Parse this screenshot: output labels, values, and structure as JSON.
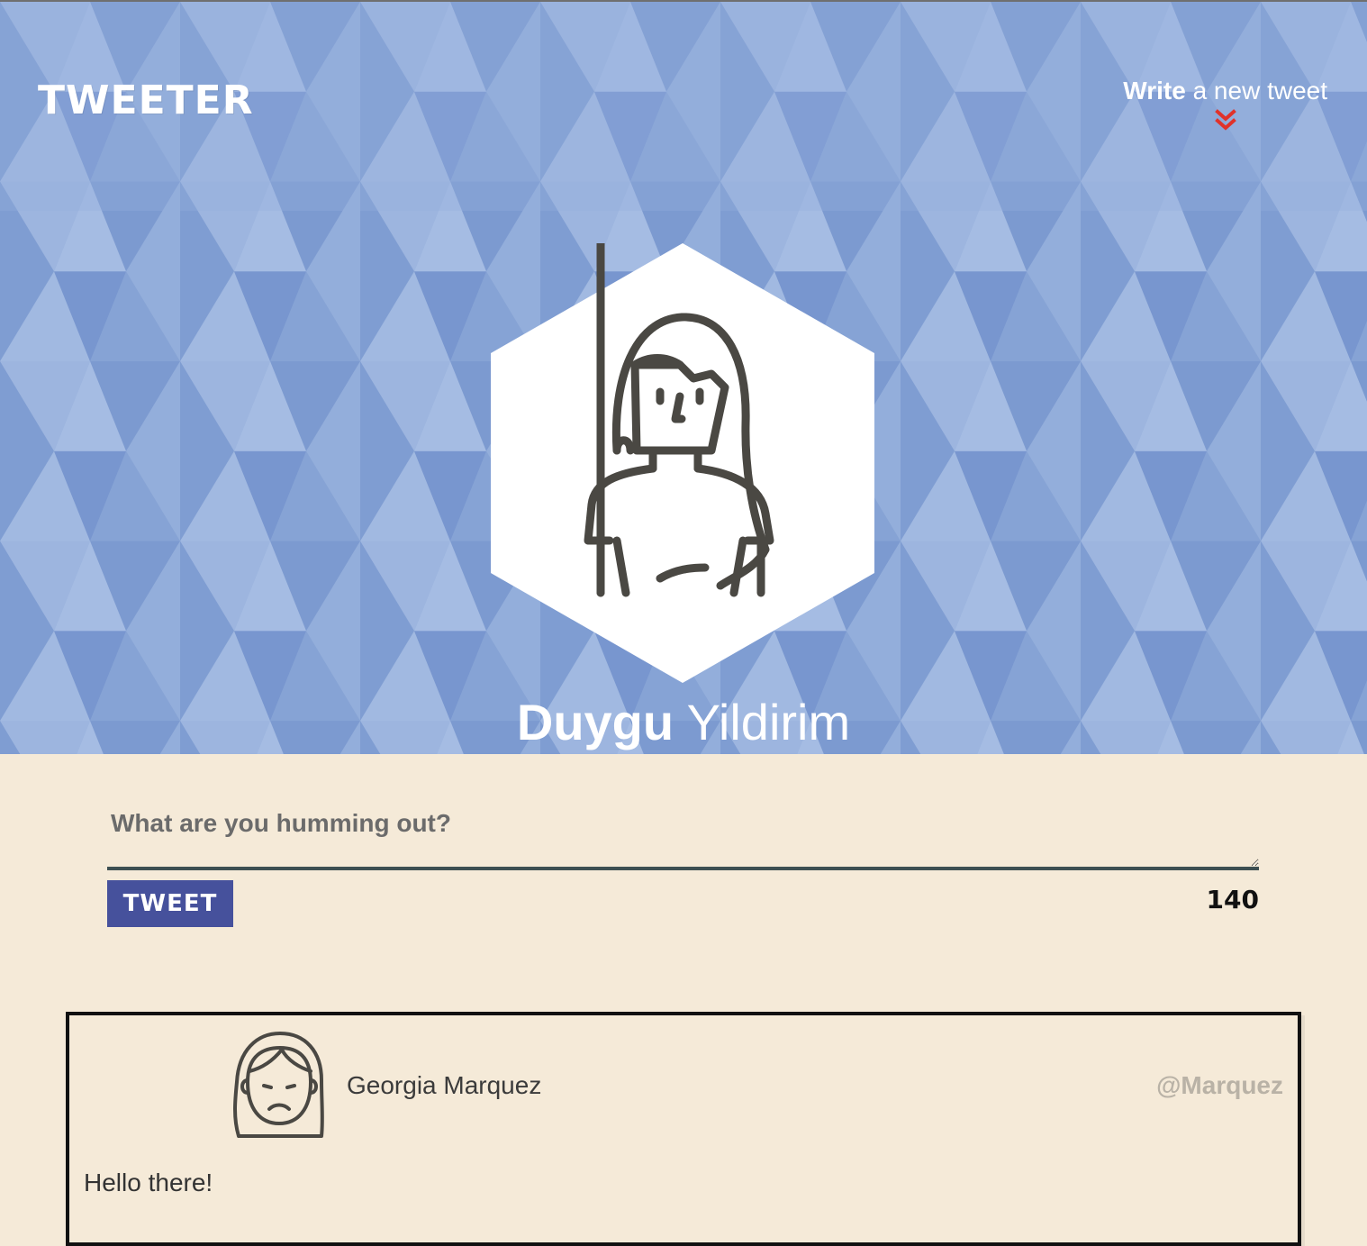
{
  "nav": {
    "brand": "TWEETER",
    "compose_strong": "Write",
    "compose_rest": " a new tweet",
    "compose_icon": "double-chevron-down-icon"
  },
  "profile": {
    "first_name": "Duygu",
    "last_name": "Yildirim",
    "avatar_icon": "person-avatar-icon"
  },
  "compose": {
    "placeholder": "What are you humming out?",
    "value": "",
    "button_label": "TWEET",
    "char_count": "140"
  },
  "tweets": [
    {
      "author": "Georgia Marquez",
      "handle": "@Marquez",
      "content": "Hello there!",
      "avatar_icon": "person-avatar-icon"
    }
  ],
  "colors": {
    "hero_bg": "#8aa6d6",
    "page_bg": "#f5ead8",
    "button_bg": "#46519c",
    "chevron": "#e0322a",
    "textarea_border": "#3d4f52"
  }
}
